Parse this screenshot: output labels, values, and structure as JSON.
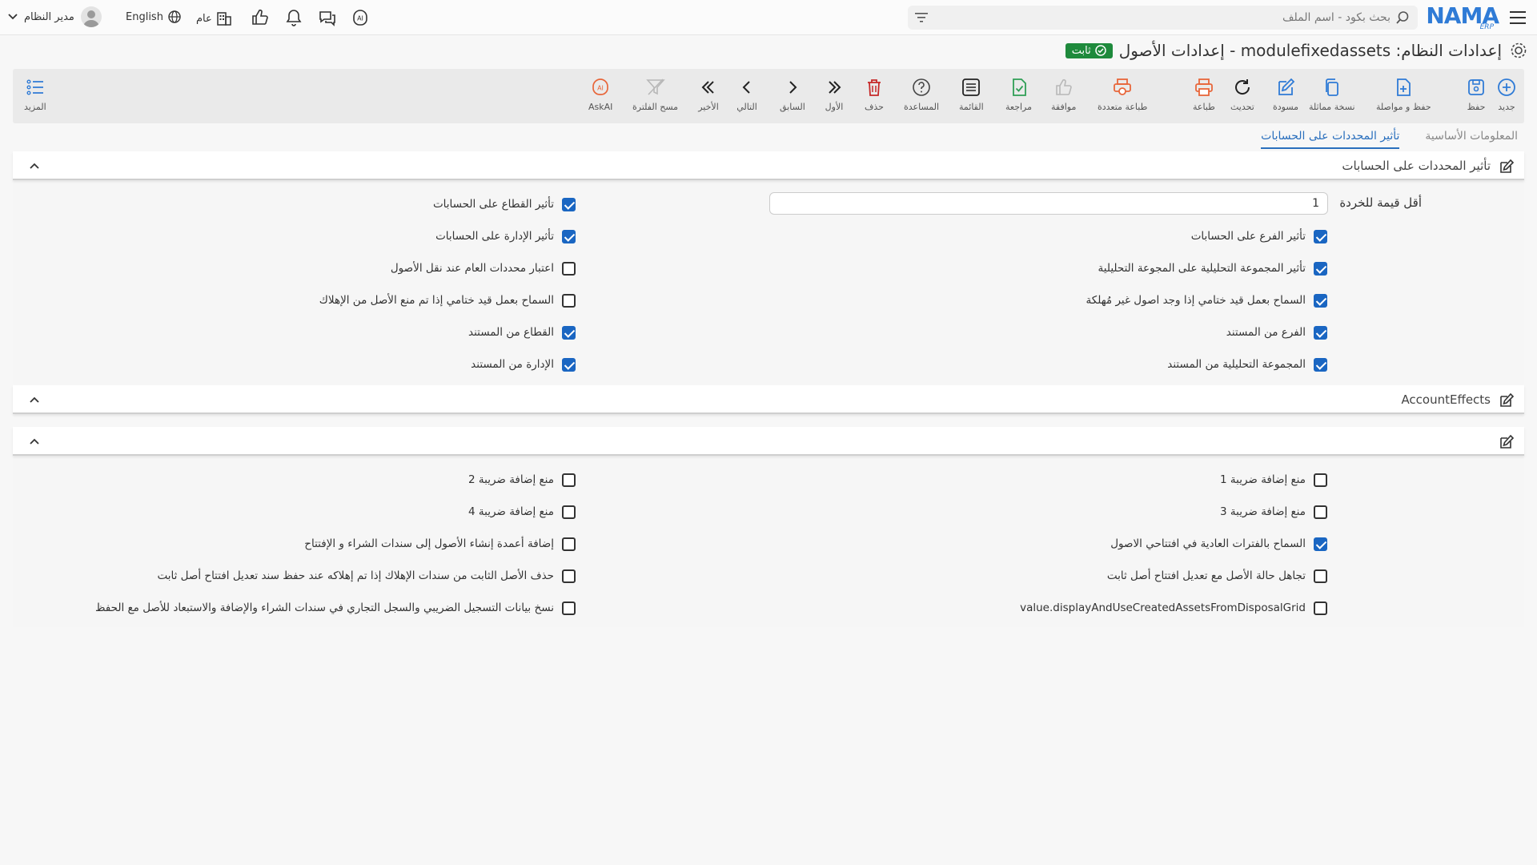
{
  "topbar": {
    "logo_text": "NAMA",
    "logo_sub": "ERP",
    "search_placeholder": "بحث بكود - اسم الملف",
    "org_label": "عام",
    "language_label": "English",
    "user_name": "مدير النظام"
  },
  "page": {
    "title": "إعدادات النظام: modulefixedassets - إعدادات الأصول",
    "status_badge": "ثابت"
  },
  "toolbar": {
    "new": "جديد",
    "save": "حفظ",
    "save_continue": "حفظ و مواصلة",
    "copy": "نسخة مماثلة",
    "draft": "مسودة",
    "refresh": "تحديث",
    "print": "طباعة",
    "multi_print": "طباعة متعددة",
    "approve": "موافقة",
    "review": "مراجعة",
    "list": "القائمة",
    "help": "المساعدة",
    "delete": "حذف",
    "first": "الأول",
    "previous": "السابق",
    "next": "التالي",
    "last": "الأخير",
    "clear_filter": "مسح الفلترة",
    "askai": "AskAI",
    "more": "المزيد"
  },
  "tabs": [
    {
      "label": "المعلومات الأساسية",
      "active": false
    },
    {
      "label": "تأثير المحددات على الحسابات",
      "active": true
    }
  ],
  "section1": {
    "title": "تأثير المحددات على الحسابات",
    "min_scrap_label": "أقل قيمة للخردة",
    "min_scrap_value": "1",
    "right_col": [
      {
        "label": "تأثير الفرع على الحسابات",
        "checked": true
      },
      {
        "label": "تأثير المجموعة التحليلية على المجوعة التحليلية",
        "checked": true
      },
      {
        "label": "السماح بعمل قيد ختامي إذا وجد اصول غير مُهلكة",
        "checked": true
      },
      {
        "label": "الفرع من المستند",
        "checked": true
      },
      {
        "label": "المجموعة التحليلية من المستند",
        "checked": true
      }
    ],
    "left_col": [
      {
        "label": "تأثير القطاع على الحسابات",
        "checked": true
      },
      {
        "label": "تأثير الإدارة على الحسابات",
        "checked": true
      },
      {
        "label": "اعتبار محددات العام عند نقل الأصول",
        "checked": false
      },
      {
        "label": "السماح بعمل قيد ختامي إذا تم منع الأصل من الإهلاك",
        "checked": false
      },
      {
        "label": "القطاع من المستند",
        "checked": true
      },
      {
        "label": "الإدارة من المستند",
        "checked": true
      }
    ]
  },
  "section2": {
    "title": "AccountEffects"
  },
  "section3": {
    "title": "",
    "right_col": [
      {
        "label": "منع إضافة ضريبة 1",
        "checked": false
      },
      {
        "label": "منع إضافة ضريبة 3",
        "checked": false
      },
      {
        "label": "السماح بالفترات العادية في افتتاحي الاصول",
        "checked": true
      },
      {
        "label": "تجاهل حالة الأصل مع تعديل افتتاح أصل ثابت",
        "checked": false
      },
      {
        "label": "value.displayAndUseCreatedAssetsFromDisposalGrid",
        "checked": false
      }
    ],
    "left_col": [
      {
        "label": "منع إضافة ضريبة 2",
        "checked": false
      },
      {
        "label": "منع إضافة ضريبة 4",
        "checked": false
      },
      {
        "label": "إضافة أعمدة إنشاء الأصول إلى سندات الشراء و الإفتتاح",
        "checked": false
      },
      {
        "label": "حذف الأصل الثابت من سندات الإهلاك إذا تم إهلاكه عند حفظ سند تعديل افتتاح أصل ثابت",
        "checked": false
      },
      {
        "label": "نسخ بيانات التسجيل الضريبي والسجل التجاري في سندات الشراء والإضافة والاستبعاد للأصل مع الحفظ",
        "checked": false
      }
    ]
  },
  "colors": {
    "primary": "#1a66c2",
    "badge_green": "#1e8a3c",
    "icon_blue": "#2f7bd6",
    "icon_orange": "#e8663a",
    "icon_green": "#2f9e55",
    "icon_red": "#c62828"
  }
}
